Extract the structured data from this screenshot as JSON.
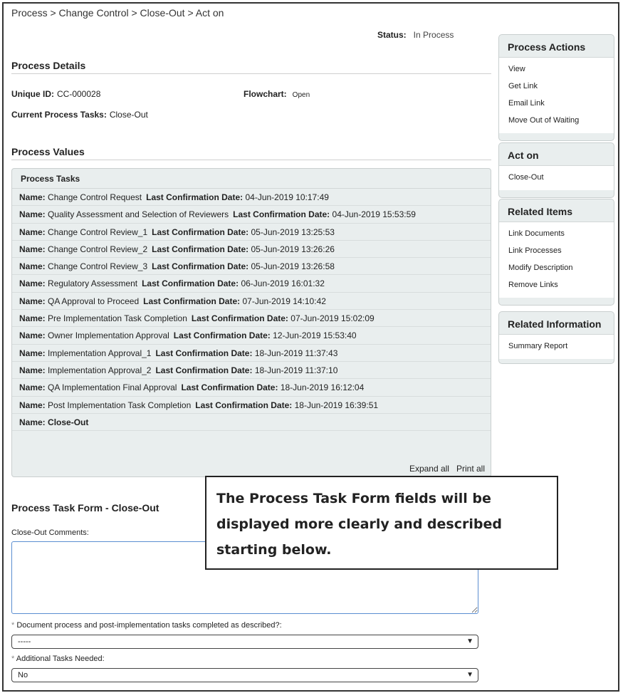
{
  "breadcrumb": "Process > Change Control > Close-Out > Act on",
  "status": {
    "label": "Status:",
    "value": "In Process"
  },
  "process_details": {
    "title": "Process Details",
    "unique_id_label": "Unique ID:",
    "unique_id_value": "CC-000028",
    "flowchart_label": "Flowchart:",
    "flowchart_value": "Open",
    "current_tasks_label": "Current Process Tasks:",
    "current_tasks_value": "Close-Out"
  },
  "process_values": {
    "title": "Process Values"
  },
  "process_tasks": {
    "header": "Process Tasks",
    "name_label": "Name:",
    "date_label": "Last Confirmation Date:",
    "rows": [
      {
        "name": "Change Control Request",
        "date": "04-Jun-2019 10:17:49"
      },
      {
        "name": "Quality Assessment and Selection of Reviewers",
        "date": "04-Jun-2019 15:53:59"
      },
      {
        "name": "Change Control Review_1",
        "date": "05-Jun-2019 13:25:53"
      },
      {
        "name": "Change Control Review_2",
        "date": "05-Jun-2019 13:26:26"
      },
      {
        "name": "Change Control Review_3",
        "date": "05-Jun-2019 13:26:58"
      },
      {
        "name": "Regulatory Assessment",
        "date": "06-Jun-2019 16:01:32"
      },
      {
        "name": "QA Approval to Proceed",
        "date": "07-Jun-2019 14:10:42"
      },
      {
        "name": "Pre Implementation Task Completion",
        "date": "07-Jun-2019 15:02:09"
      },
      {
        "name": "Owner Implementation Approval",
        "date": "12-Jun-2019 15:53:40"
      },
      {
        "name": "Implementation Approval_1",
        "date": "18-Jun-2019 11:37:43"
      },
      {
        "name": "Implementation Approval_2",
        "date": "18-Jun-2019 11:37:10"
      },
      {
        "name": "QA Implementation Final Approval",
        "date": "18-Jun-2019 16:12:04"
      },
      {
        "name": "Post Implementation Task Completion",
        "date": "18-Jun-2019 16:39:51"
      }
    ],
    "last_row_name": "Close-Out",
    "expand_all": "Expand all",
    "print_all": "Print all"
  },
  "task_form": {
    "title": "Process Task Form - Close-Out",
    "comments_label": "Close-Out Comments:",
    "comments_value": "",
    "q1_req": "*",
    "q1_label": "Document process and post-implementation tasks completed as described?:",
    "q1_value": "-----",
    "q2_req": "*",
    "q2_label": "Additional Tasks Needed:",
    "q2_value": "No"
  },
  "sidebar": {
    "process_actions": {
      "title": "Process Actions",
      "items": [
        "View",
        "Get Link",
        "Email Link",
        "Move Out of Waiting"
      ]
    },
    "act_on": {
      "title": "Act on",
      "items": [
        "Close-Out"
      ]
    },
    "related_items": {
      "title": "Related Items",
      "items": [
        "Link Documents",
        "Link Processes",
        "Modify Description",
        "Remove Links"
      ]
    },
    "related_information": {
      "title": "Related Information",
      "items": [
        "Summary Report"
      ]
    }
  },
  "callout": {
    "text": "The Process Task Form fields will be displayed more clearly and described starting below."
  }
}
